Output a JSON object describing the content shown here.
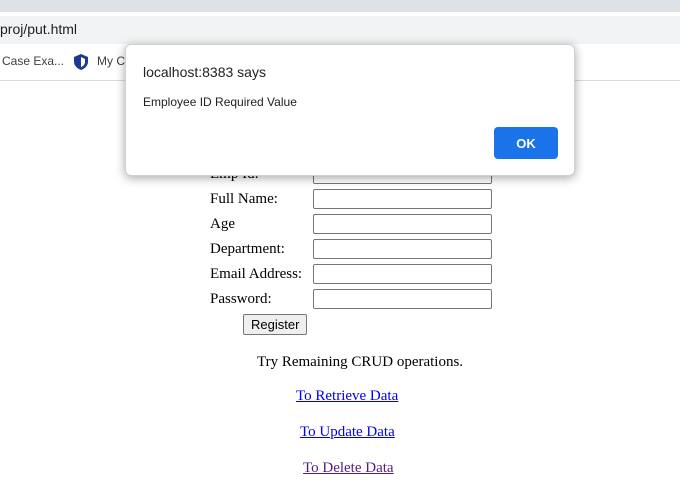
{
  "browser": {
    "url": "proj/put.html",
    "bookmarks": [
      "Case Exa...",
      "My C"
    ]
  },
  "form": {
    "fields": [
      {
        "label": "Emp Id:",
        "value": ""
      },
      {
        "label": "Full Name:",
        "value": ""
      },
      {
        "label": "Age",
        "value": ""
      },
      {
        "label": "Department:",
        "value": ""
      },
      {
        "label": "Email Address:",
        "value": ""
      },
      {
        "label": "Password:",
        "value": ""
      }
    ],
    "register_label": "Register"
  },
  "crud": {
    "note": "Try Remaining CRUD operations.",
    "links": [
      "To Retrieve Data",
      "To Update Data",
      "To Delete Data"
    ]
  },
  "dialog": {
    "title": "localhost:8383 says",
    "message": "Employee ID Required Value",
    "ok_label": "OK"
  }
}
